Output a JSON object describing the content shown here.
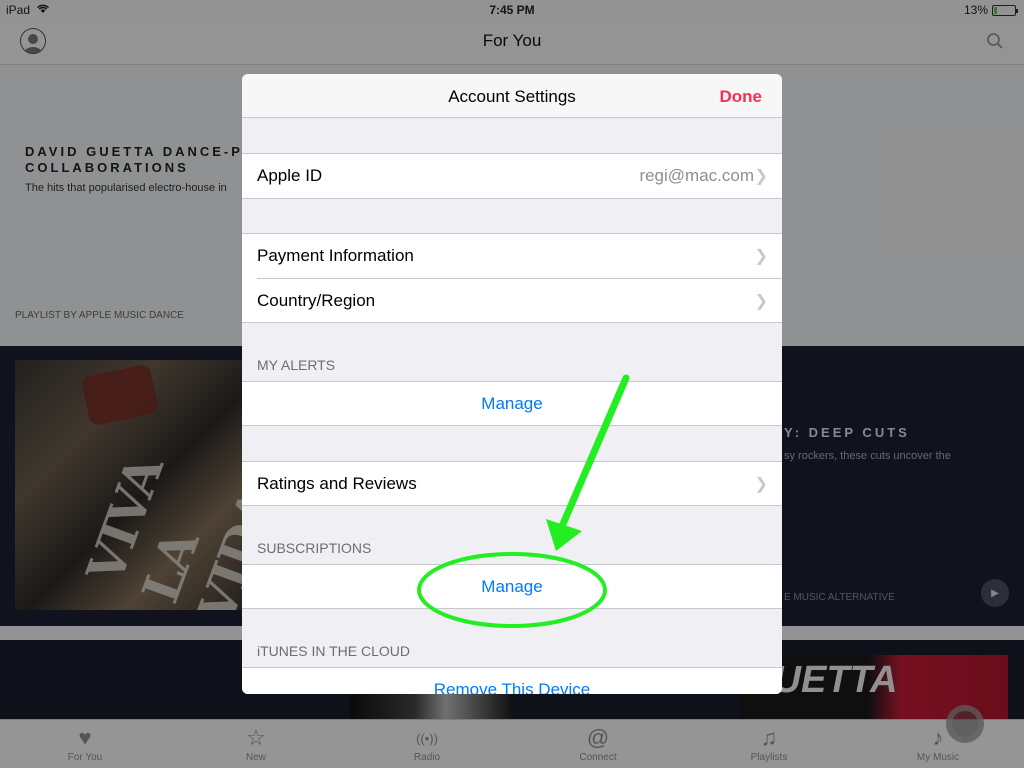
{
  "status_bar": {
    "carrier": "iPad",
    "time": "7:45 PM",
    "battery_pct": "13%",
    "battery_level": 0.13
  },
  "background": {
    "nav_title": "For You",
    "hero": {
      "title": "DAVID GUETTA DANCE-PO COLLABORATIONS",
      "description": "The hits that popularised electro-house in",
      "footer": "PLAYLIST BY APPLE MUSIC DANCE"
    },
    "album_text": "VIVA LA VIDA",
    "second": {
      "title": "Y: DEEP CUTS",
      "description": "sy rockers, these cuts uncover the",
      "footer": "E MUSIC ALTERNATIVE"
    },
    "lower_art_text": "GUETTA"
  },
  "tabs": [
    {
      "label": "For You",
      "icon": "heart-icon",
      "glyph": "♥"
    },
    {
      "label": "New",
      "icon": "star-icon",
      "glyph": "☆"
    },
    {
      "label": "Radio",
      "icon": "radio-icon",
      "glyph": "((•))"
    },
    {
      "label": "Connect",
      "icon": "at-icon",
      "glyph": "@"
    },
    {
      "label": "Playlists",
      "icon": "playlists-icon",
      "glyph": "♫"
    },
    {
      "label": "My Music",
      "icon": "note-icon",
      "glyph": "♪"
    }
  ],
  "modal": {
    "title": "Account Settings",
    "done": "Done",
    "apple_id": {
      "label": "Apple ID",
      "value": "regi@mac.com"
    },
    "payment": "Payment Information",
    "country": "Country/Region",
    "alerts_header": "MY ALERTS",
    "alerts_manage": "Manage",
    "ratings": "Ratings and Reviews",
    "subscriptions_header": "SUBSCRIPTIONS",
    "subscriptions_manage": "Manage",
    "cloud_header": "iTUNES IN THE CLOUD",
    "remove_device": "Remove This Device"
  },
  "colors": {
    "accent_blue": "#007aff",
    "done_pink": "#ff2d55",
    "annotation_green": "#22ee22"
  }
}
